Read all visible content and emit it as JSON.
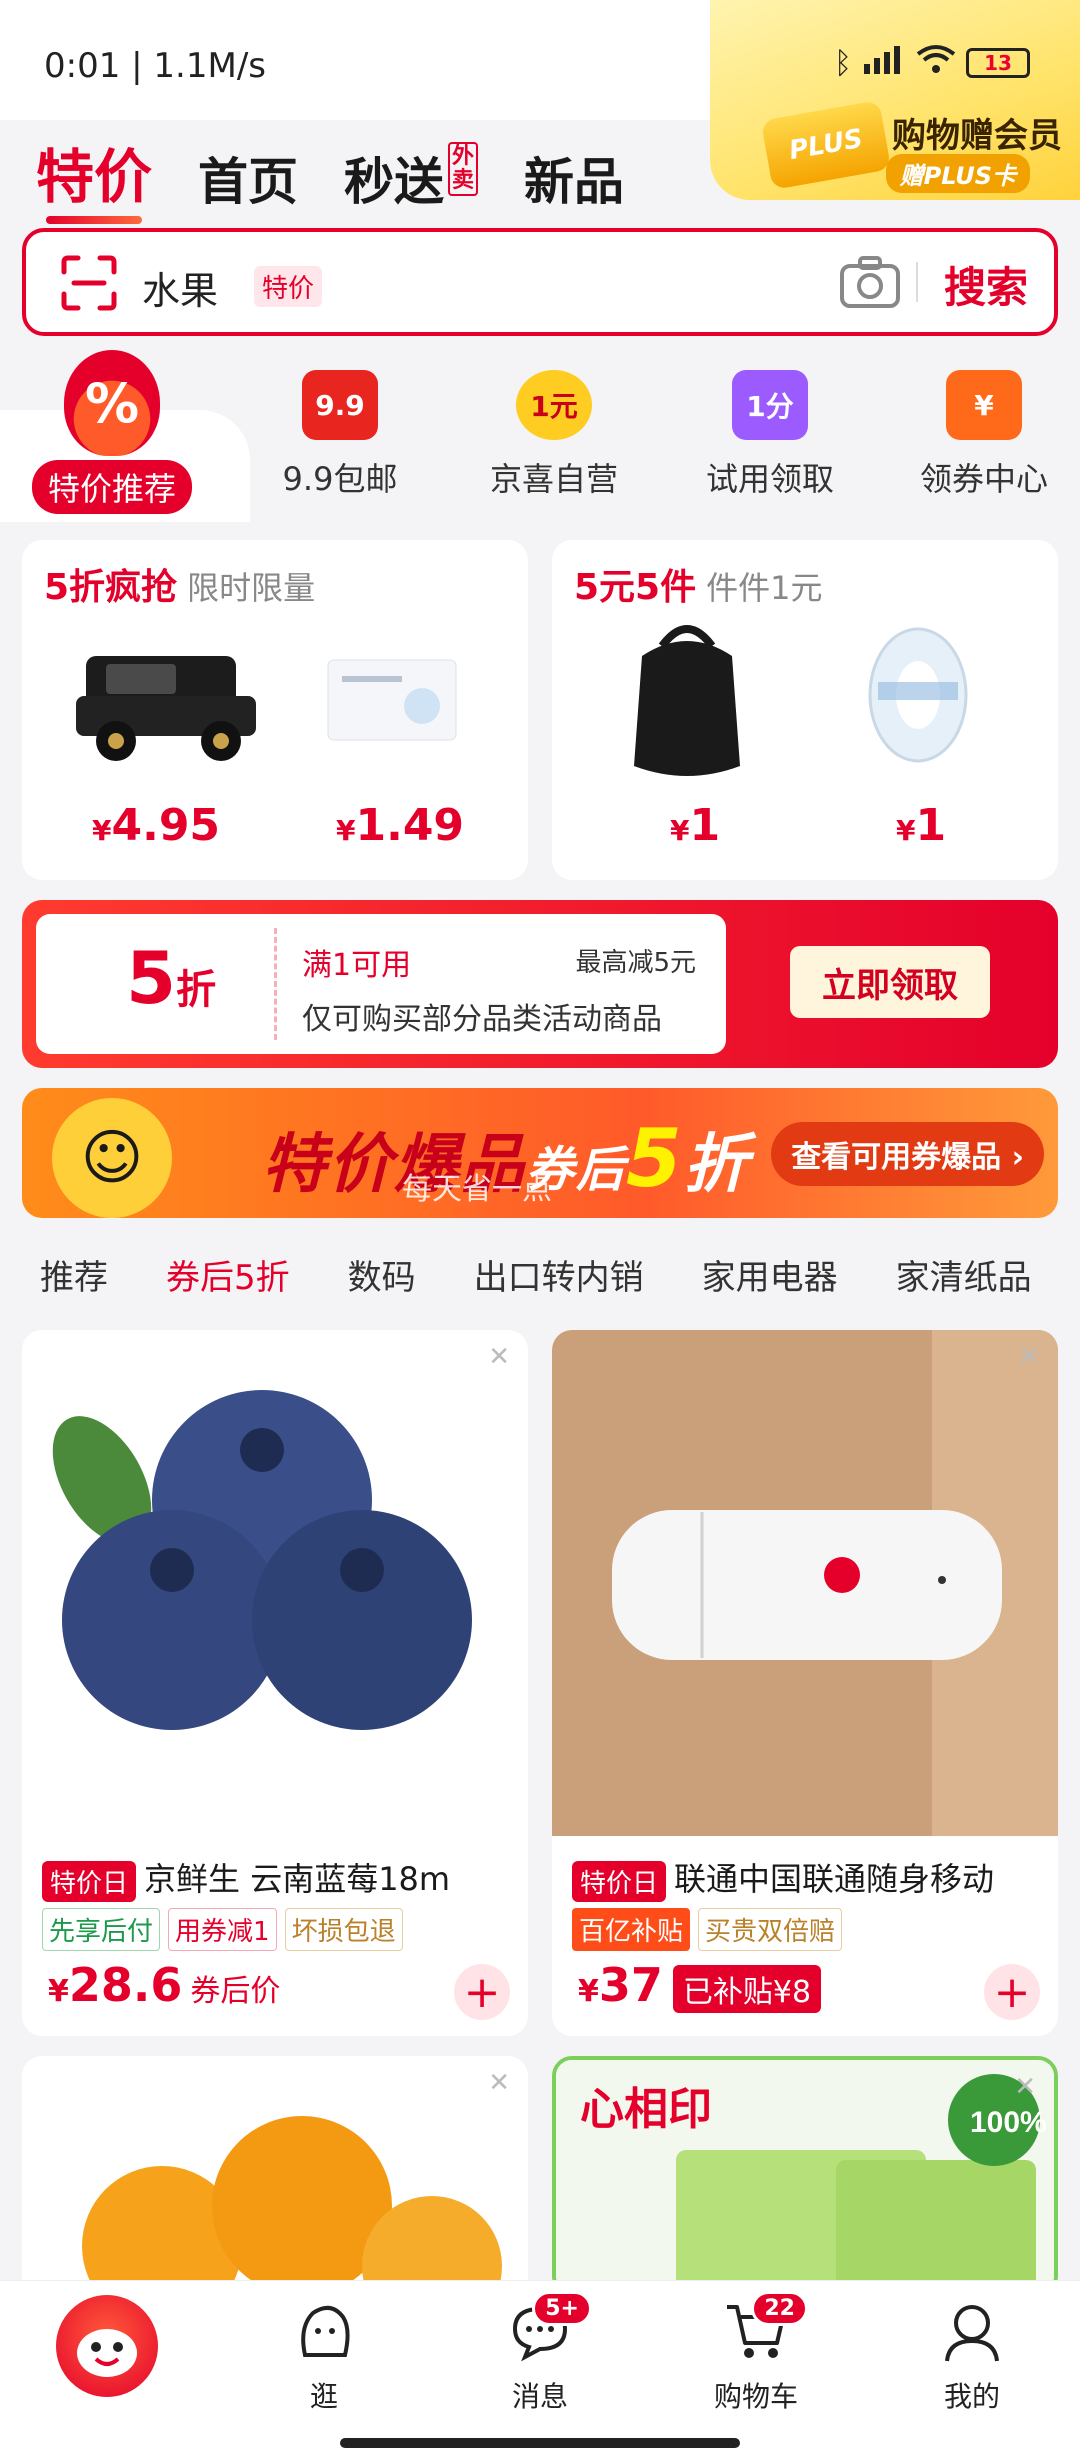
{
  "status": {
    "time": "0:01 | 1.1M/s",
    "battery": "13"
  },
  "plus_promo": {
    "badge": "PLUS",
    "title": "购物赠会员",
    "sub": "赠PLUS卡"
  },
  "top_tabs": [
    {
      "label": "特价",
      "active": true
    },
    {
      "label": "首页",
      "active": false
    },
    {
      "label": "秒送",
      "active": false
    },
    {
      "label": "新品",
      "active": false
    }
  ],
  "takeout_tag": "外卖",
  "search": {
    "text": "水果",
    "tag": "特价",
    "button": "搜索"
  },
  "categories": [
    {
      "label": "特价推荐",
      "icon": "percent-icon"
    },
    {
      "label": "9.9包邮",
      "icon": "nine-nine-icon",
      "icon_text": "9.9"
    },
    {
      "label": "京喜自营",
      "icon": "one-yuan-icon",
      "icon_text": "1元"
    },
    {
      "label": "试用领取",
      "icon": "one-point-icon",
      "icon_text": "1分"
    },
    {
      "label": "领券中心",
      "icon": "coupon-icon",
      "icon_text": "¥"
    }
  ],
  "deal_cards": [
    {
      "head_red": "5折疯抢",
      "head_sub": "限时限量",
      "prices": [
        "4.95",
        "1.49"
      ]
    },
    {
      "head_red": "5元5件",
      "head_sub": "件件1元",
      "prices": [
        "1",
        "1"
      ]
    }
  ],
  "currency": "¥",
  "coupon": {
    "value": "5",
    "unit": "折",
    "condition": "满1可用",
    "max": "最高减5元",
    "scope": "仅可购买部分品类活动商品",
    "button": "立即领取"
  },
  "hot_banner": {
    "title": "特价爆品",
    "title_mid": "券后",
    "five": "5",
    "title_end": "折",
    "sub": "每天省一点",
    "button": "查看可用券爆品 ›"
  },
  "filter_tabs": [
    {
      "label": "推荐",
      "active": false
    },
    {
      "label": "券后5折",
      "active": true
    },
    {
      "label": "数码",
      "active": false
    },
    {
      "label": "出口转内销",
      "active": false
    },
    {
      "label": "家用电器",
      "active": false
    },
    {
      "label": "家清纸品",
      "active": false
    }
  ],
  "products": [
    {
      "badge": "特价日",
      "title": "京鲜生 云南蓝莓18m",
      "tags": [
        "先享后付",
        "用券减1",
        "坏损包退"
      ],
      "price": "28.6",
      "price_note": "券后价"
    },
    {
      "badge": "特价日",
      "title": "联通中国联通随身移动",
      "tags": [
        "百亿补贴",
        "买贵双倍赔"
      ],
      "price": "37",
      "subsidy": "已补贴¥8"
    }
  ],
  "bottom_nav": [
    {
      "label": "",
      "icon": "jd-home-icon"
    },
    {
      "label": "逛",
      "icon": "browse-icon"
    },
    {
      "label": "消息",
      "icon": "message-icon",
      "badge": "5+"
    },
    {
      "label": "购物车",
      "icon": "cart-icon",
      "badge": "22"
    },
    {
      "label": "我的",
      "icon": "profile-icon"
    }
  ],
  "colors": {
    "accent": "#e4002b",
    "plus_gold": "#ffd23c"
  }
}
